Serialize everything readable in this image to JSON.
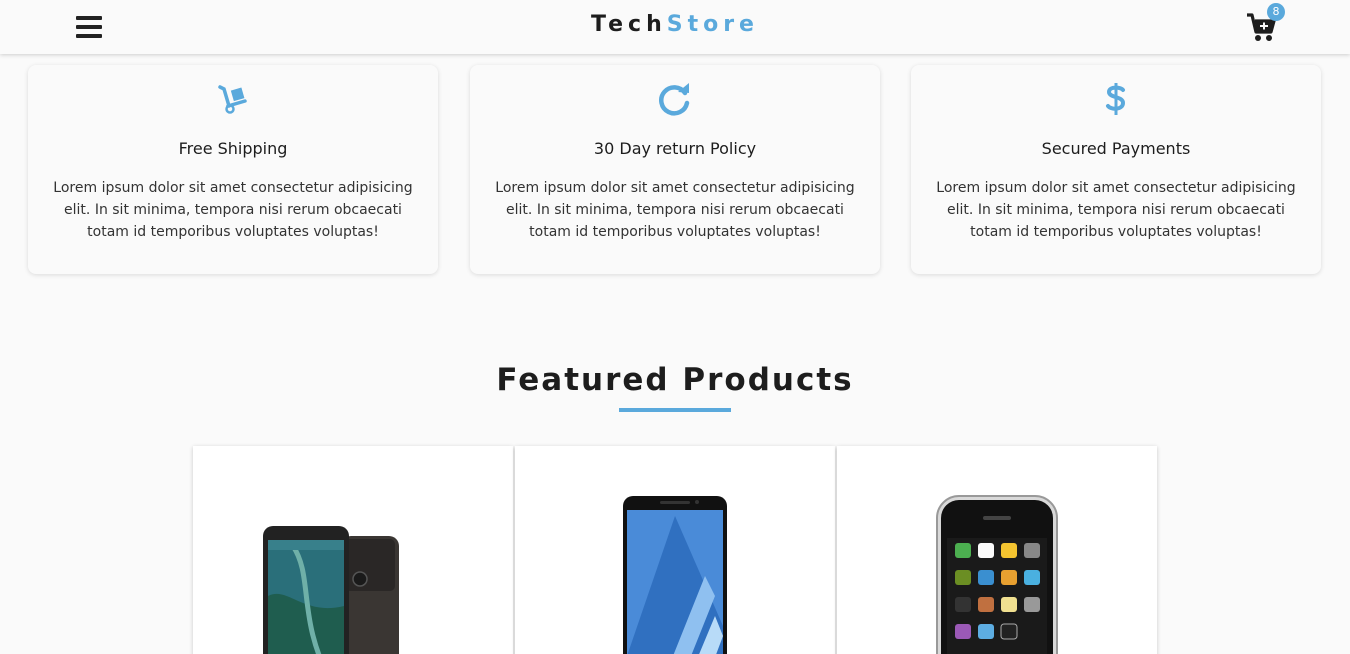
{
  "header": {
    "brand_part1": "Tech",
    "brand_part2": "Store",
    "cart_count": "8",
    "menu_icon": "hamburger-menu-icon",
    "cart_icon": "shopping-cart-icon"
  },
  "colors": {
    "accent": "#5aa9dc",
    "text": "#1d1d1d",
    "background": "#fafafa"
  },
  "features": [
    {
      "icon": "dolly-icon",
      "title": "Free Shipping",
      "text": "Lorem ipsum dolor sit amet consectetur adipisicing elit. In sit minima, tempora nisi rerum obcaecati totam id temporibus voluptates voluptas!"
    },
    {
      "icon": "redo-icon",
      "title": "30 Day return Policy",
      "text": "Lorem ipsum dolor sit amet consectetur adipisicing elit. In sit minima, tempora nisi rerum obcaecati totam id temporibus voluptates voluptas!"
    },
    {
      "icon": "dollar-icon",
      "title": "Secured Payments",
      "text": "Lorem ipsum dolor sit amet consectetur adipisicing elit. In sit minima, tempora nisi rerum obcaecati totam id temporibus voluptates voluptas!"
    }
  ],
  "featured": {
    "title": "Featured Products",
    "products": [
      {
        "image": "google-pixel-phone-image"
      },
      {
        "image": "samsung-galaxy-phone-image"
      },
      {
        "image": "iphone-phone-image"
      }
    ]
  }
}
